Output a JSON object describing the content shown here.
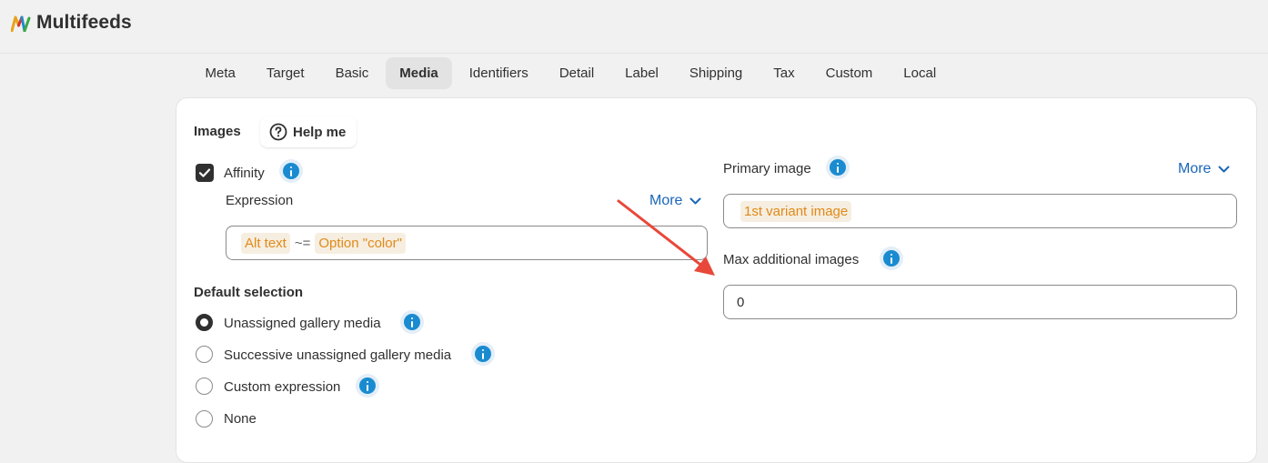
{
  "app": {
    "title": "Multifeeds"
  },
  "tabs": [
    {
      "label": "Meta"
    },
    {
      "label": "Target"
    },
    {
      "label": "Basic"
    },
    {
      "label": "Media"
    },
    {
      "label": "Identifiers"
    },
    {
      "label": "Detail"
    },
    {
      "label": "Label"
    },
    {
      "label": "Shipping"
    },
    {
      "label": "Tax"
    },
    {
      "label": "Custom"
    },
    {
      "label": "Local"
    }
  ],
  "active_tab": "Media",
  "images": {
    "section_title": "Images",
    "help_button": "Help me",
    "affinity": {
      "label": "Affinity",
      "checked": true
    },
    "expression": {
      "label": "Expression",
      "more_label": "More",
      "token1": "Alt text",
      "operator": "~=",
      "token2": "Option \"color\""
    },
    "default_selection": {
      "title": "Default selection",
      "options": [
        {
          "label": "Unassigned gallery media",
          "checked": true
        },
        {
          "label": "Successive unassigned gallery media",
          "checked": false
        },
        {
          "label": "Custom expression",
          "checked": false
        },
        {
          "label": "None",
          "checked": false
        }
      ]
    },
    "primary_image": {
      "label": "Primary image",
      "more_label": "More",
      "value": "1st variant image"
    },
    "max_additional": {
      "label": "Max additional images",
      "value": "0"
    }
  },
  "colors": {
    "accent_link": "#1a66b8",
    "info_icon": "#1a8bd0",
    "token_text": "#e08a1a",
    "annotation_arrow": "#e8483a"
  }
}
